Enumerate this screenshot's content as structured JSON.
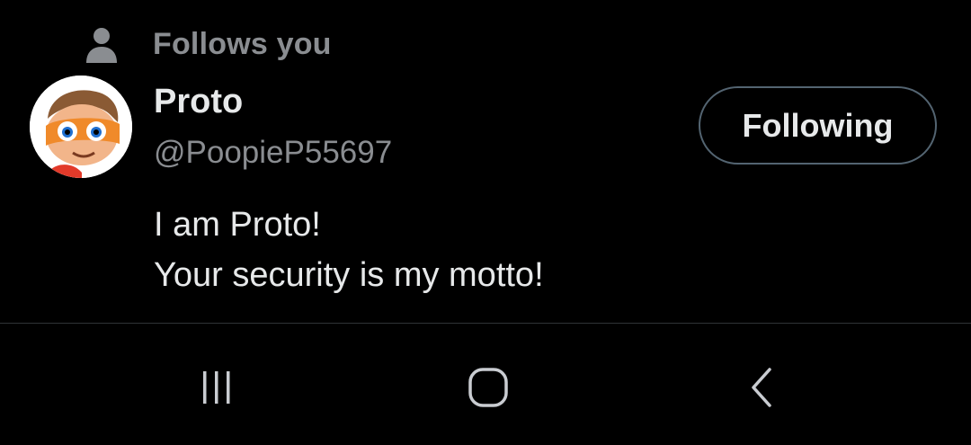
{
  "follows_label": "Follows you",
  "profile": {
    "name": "Proto",
    "handle": "@PoopieP55697",
    "bio_lines": [
      "I am Proto!",
      "Your security is my motto!"
    ]
  },
  "follow_button": {
    "label": "Following"
  },
  "icons": {
    "follows": "person-icon",
    "recents": "recent-apps-icon",
    "home": "home-icon",
    "back": "back-icon"
  },
  "colors": {
    "background": "#000000",
    "primary_text": "#e7e9ea",
    "secondary_text": "#8a8d91",
    "button_border": "#536471",
    "divider": "#2f3336"
  }
}
